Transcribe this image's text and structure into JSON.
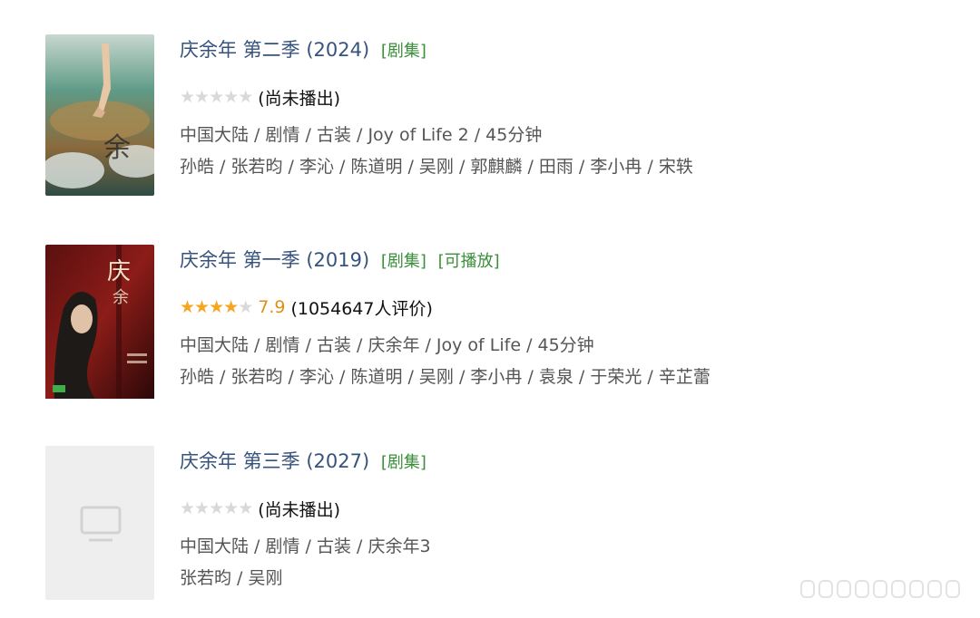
{
  "results": [
    {
      "title": "庆余年 第二季 (2024)",
      "tags": [
        "[剧集]"
      ],
      "stars_filled": 0,
      "score": "",
      "rating_text": "(尚未播出)",
      "meta": "中国大陆 / 剧情 / 古装 / Joy of Life 2 / 45分钟",
      "cast": "孙皓 / 张若昀 / 李沁 / 陈道明 / 吴刚 / 郭麒麟 / 田雨 / 李小冉 / 宋轶",
      "poster": "poster-season2"
    },
    {
      "title": "庆余年 第一季 (2019)",
      "tags": [
        "[剧集]",
        "[可播放]"
      ],
      "stars_filled": 4,
      "score": "7.9",
      "rating_text": "(1054647人评价)",
      "meta": "中国大陆 / 剧情 / 古装 / 庆余年 / Joy of Life / 45分钟",
      "cast": "孙皓 / 张若昀 / 李沁 / 陈道明 / 吴刚 / 李小冉 / 袁泉 / 于荣光 / 辛芷蕾",
      "poster": "poster-season1"
    },
    {
      "title": "庆余年 第三季 (2027)",
      "tags": [
        "[剧集]"
      ],
      "stars_filled": 0,
      "score": "",
      "rating_text": "(尚未播出)",
      "meta": "中国大陆 / 剧情 / 古装 / 庆余年3",
      "cast": "张若昀 / 吴刚",
      "poster": "poster-placeholder"
    }
  ],
  "colors": {
    "title": "#37537d",
    "tag": "#3b8f3b",
    "star_on": "#f5a623",
    "star_off": "#d9d9d9",
    "meta": "#555555"
  }
}
